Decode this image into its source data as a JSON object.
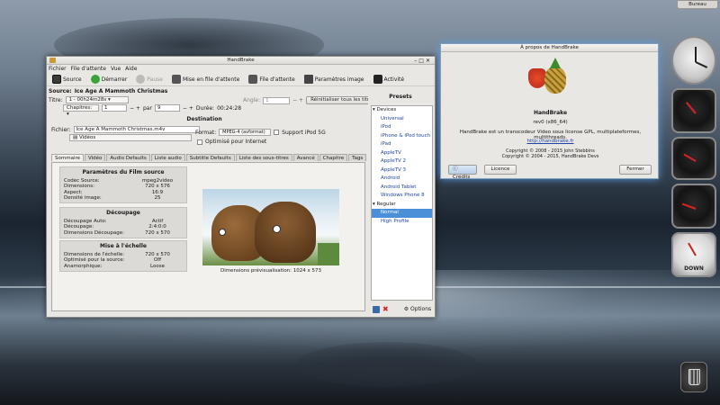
{
  "desktop": {
    "top_button": "Bureau"
  },
  "main_window": {
    "title": "HandBrake",
    "menu": [
      "Fichier",
      "File d'attente",
      "Vue",
      "Aide"
    ],
    "toolbar": {
      "source": "Source",
      "start": "Démarrer",
      "pause": "Pause",
      "add_queue": "Mise en file d'attente",
      "queue": "File d'attente",
      "picture_settings": "Paramètres image",
      "activity": "Activité"
    },
    "source_label": "Source:",
    "source_value": "Ice Age A Mammoth Christmas",
    "title_label": "Titre:",
    "title_value": "1 - 00h24m28s",
    "angle_label": "Angle:",
    "angle_value": "1",
    "reset_titles": "Réinitialiser tous les titres",
    "chapters_value": "Chapitres:",
    "chapter_start": "1",
    "par_label": "par",
    "chapter_end": "9",
    "duration_label": "Durée:",
    "duration_value": "00:24:28",
    "destination": {
      "heading": "Destination",
      "file_label": "Fichier:",
      "file_value": "Ice Age A Mammoth Christmas.m4v",
      "folder_value": "Vidéos",
      "format_label": "Format:",
      "format_value": "MPEG-4 (avformat)",
      "ipod_label": "Support iPod 5G",
      "web_label": "Optimisé pour Internet"
    },
    "tabs": [
      "Sommaire",
      "Vidéo",
      "Audio Defaults",
      "Liste audio",
      "Subtitle Defaults",
      "Liste des sous-titres",
      "Avancé",
      "Chapitre",
      "Tags"
    ],
    "summary": {
      "source_params": {
        "heading": "Paramètres du Film source",
        "rows": [
          {
            "label": "Codec Source:",
            "value": "mpeg2video"
          },
          {
            "label": "Dimensions:",
            "value": "720 x 576"
          },
          {
            "label": "Aspect:",
            "value": "16:9"
          },
          {
            "label": "Densité image:",
            "value": "25"
          }
        ]
      },
      "cropping": {
        "heading": "Découpage",
        "rows": [
          {
            "label": "Découpage Auto:",
            "value": "Actif"
          },
          {
            "label": "Découpage:",
            "value": "2:4:0:0"
          },
          {
            "label": "Dimensions Découpage:",
            "value": "720 x 570"
          }
        ]
      },
      "scaling": {
        "heading": "Mise à l'échelle",
        "rows": [
          {
            "label": "Dimensions de l'échelle:",
            "value": "720 x 570"
          },
          {
            "label": "Optimisé pour la source:",
            "value": "Off"
          },
          {
            "label": "Anamorphique:",
            "value": "Loose"
          }
        ]
      },
      "preview_caption": "Dimensions prévisualisation:  1024 x 573"
    },
    "presets": {
      "heading": "Presets",
      "groups": [
        {
          "name": "Devices",
          "items": [
            "Universal",
            "iPod",
            "iPhone & iPod touch",
            "iPad",
            "AppleTV",
            "AppleTV 2",
            "AppleTV 3",
            "Android",
            "Android Tablet",
            "Windows Phone 8"
          ]
        },
        {
          "name": "Regular",
          "items": [
            "Normal",
            "High Profile"
          ]
        }
      ],
      "selected": "Normal",
      "options_label": "Options"
    }
  },
  "about_dialog": {
    "title": "À propos de HandBrake",
    "app_name": "HandBrake",
    "version": "rev0 (x86_64)",
    "description": "HandBrake est un transcodeur Video sous license GPL, multiplateformes, multithreads.",
    "link": "http://handbrake.fr",
    "copyright1": "Copyright © 2008 - 2015 John Stebbins",
    "copyright2": "Copyright © 2004 - 2015, HandBrake Devs",
    "credits_btn": "Crédits",
    "license_btn": "Licence",
    "close_btn": "Fermer"
  },
  "widgets": {
    "net_label": "DOWN"
  },
  "colors": {
    "selection": "#4a90d9",
    "link": "#2244aa",
    "about_glow": "#5aa0e6"
  }
}
